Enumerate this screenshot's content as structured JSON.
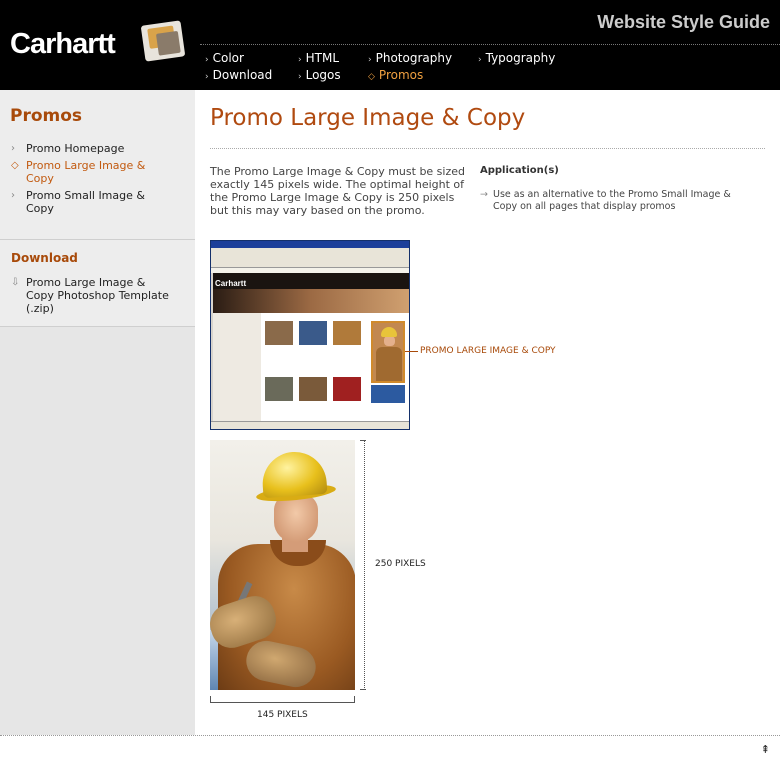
{
  "header": {
    "logo_text": "Carhartt",
    "site_title": "Website Style Guide",
    "nav": [
      {
        "label": "Color",
        "active": false
      },
      {
        "label": "HTML",
        "active": false
      },
      {
        "label": "Photography",
        "active": false
      },
      {
        "label": "Typography",
        "active": false
      },
      {
        "label": "Download",
        "active": false
      },
      {
        "label": "Logos",
        "active": false
      },
      {
        "label": "Promos",
        "active": true
      }
    ]
  },
  "sidebar": {
    "section_title": "Promos",
    "items": [
      {
        "label": "Promo Homepage",
        "active": false
      },
      {
        "label": "Promo Large Image & Copy",
        "active": true
      },
      {
        "label": "Promo Small Image & Copy",
        "active": false
      }
    ],
    "download_title": "Download",
    "download_item": "Promo Large Image & Copy Photoshop Template (.zip)"
  },
  "main": {
    "title": "Promo Large Image & Copy",
    "intro": "The Promo Large Image & Copy must be sized exactly 145 pixels wide. The optimal height of the Promo Large Image & Copy is 250 pixels but this may vary based on the promo.",
    "application_heading": "Application(s)",
    "application_item": "Use as an alternative to the Promo Small Image & Copy on all pages that display promos",
    "callout_label": "PROMO LARGE IMAGE & COPY",
    "height_label": "250 PIXELS",
    "width_label": "145 PIXELS"
  },
  "colors": {
    "accent": "#a84a0a",
    "header_bg": "#000000",
    "sidebar_bg": "#e6e6e6"
  },
  "icons": {
    "nav_bullet": "diamond-arrow-icon",
    "back_to_top": "up-arrow-icon",
    "download": "download-icon"
  }
}
